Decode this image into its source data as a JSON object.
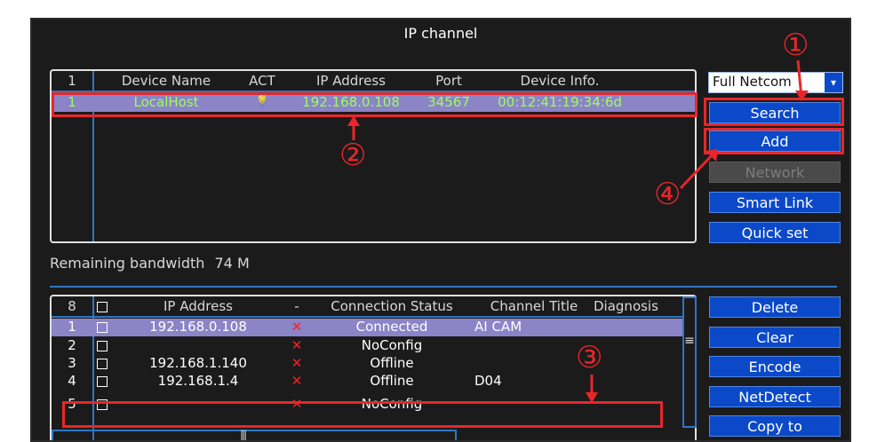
{
  "window": {
    "title": "IP channel"
  },
  "search_table": {
    "columns": [
      "1",
      "Device Name",
      "ACT",
      "IP Address",
      "Port",
      "Device Info."
    ],
    "rows": [
      {
        "index": "1",
        "device_name": "LocalHost",
        "act": "💡",
        "ip": "192.168.0.108",
        "port": "34567",
        "info": "00:12:41:19:34:6d"
      }
    ]
  },
  "protocol_select": {
    "value": "Full Netcom",
    "arrow": "▾"
  },
  "right_buttons_top": {
    "search": "Search",
    "add": "Add",
    "network": "Network",
    "smart_link": "Smart Link",
    "quick_set": "Quick set"
  },
  "bandwidth": {
    "label": "Remaining bandwidth",
    "value": "74 M"
  },
  "channel_table": {
    "columns": [
      "8",
      "",
      "IP Address",
      "-",
      "Connection Status",
      "Channel Title",
      "Diagnosis"
    ],
    "rows": [
      {
        "index": "1",
        "ip": "192.168.0.108",
        "status": "Connected",
        "title": "AI CAM"
      },
      {
        "index": "2",
        "ip": "",
        "status": "NoConfig",
        "title": ""
      },
      {
        "index": "3",
        "ip": "192.168.1.140",
        "status": "Offline",
        "title": ""
      },
      {
        "index": "4",
        "ip": "192.168.1.4",
        "status": "Offline",
        "title": "D04"
      },
      {
        "index": "5",
        "ip": "",
        "status": "NoConfig",
        "title": ""
      }
    ],
    "x_mark": "✕",
    "scroll_grip": "≡",
    "hscroll_grip": "|||"
  },
  "right_buttons_bottom": {
    "delete": "Delete",
    "clear": "Clear",
    "encode": "Encode",
    "net_detect": "NetDetect",
    "copy_to": "Copy to"
  },
  "annotations": [
    "①",
    "②",
    "③",
    "④"
  ],
  "colors": {
    "accent": "#0b49c8",
    "annotation": "#e8262a",
    "selected_row": "#8b84c7",
    "row_text_green": "#9cff5a"
  }
}
